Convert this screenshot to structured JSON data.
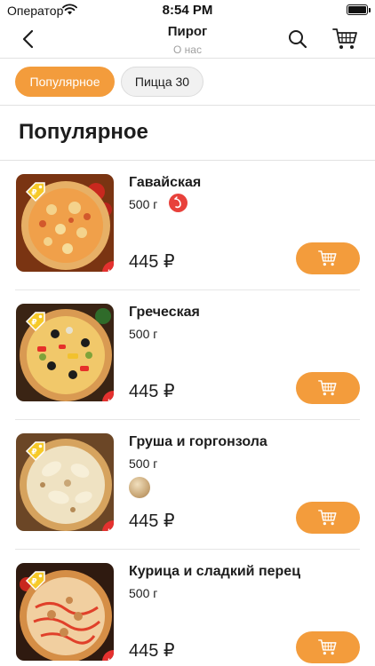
{
  "status_bar": {
    "carrier": "Оператор",
    "time": "8:54 PM",
    "battery_level": 1.0
  },
  "nav": {
    "title": "Пирог",
    "subtitle": "О нас",
    "icons": [
      "back-chevron-icon",
      "search-icon",
      "cart-icon"
    ]
  },
  "tabs": [
    {
      "label": "Популярное",
      "active": true
    },
    {
      "label": "Пицца 30",
      "active": false
    }
  ],
  "section": {
    "title": "Популярное"
  },
  "colors": {
    "accent": "#f39c3c",
    "badge_red": "#e5312f",
    "divider": "#e2e2e2"
  },
  "products": [
    {
      "name": "Гавайская",
      "weight": "500 г",
      "price": "445 ₽",
      "badge": "HIT",
      "extra_icon": "spicy-icon"
    },
    {
      "name": "Греческая",
      "weight": "500 г",
      "price": "445 ₽",
      "badge": "HIT",
      "extra_icon": ""
    },
    {
      "name": "Груша и горгонзола",
      "weight": "500 г",
      "price": "445 ₽",
      "badge": "HIT",
      "extra_icon": "topping-icon"
    },
    {
      "name": "Курица и сладкий перец",
      "weight": "500 г",
      "price": "445 ₽",
      "badge": "HIT",
      "extra_icon": ""
    }
  ]
}
